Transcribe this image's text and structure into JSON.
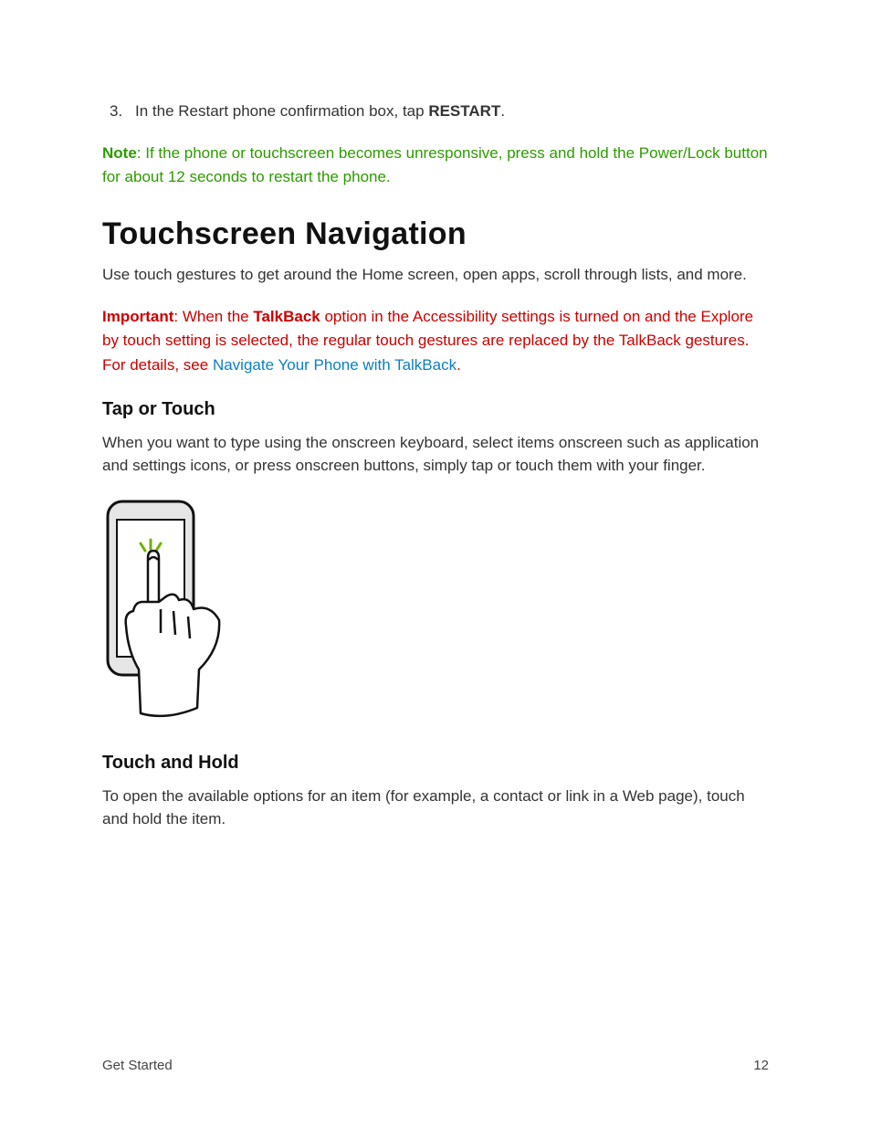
{
  "list": {
    "marker": "3.",
    "prefix": "In the Restart phone confirmation box, tap ",
    "bold": "RESTART",
    "suffix": "."
  },
  "note": {
    "label": "Note",
    "rest": ": If the phone or touchscreen becomes unresponsive, press and hold the Power/Lock button for about 12 seconds to restart the phone."
  },
  "heading": "Touchscreen Navigation",
  "intro": "Use touch gestures to get around the Home screen, open apps, scroll through lists, and more.",
  "important": {
    "label": "Important",
    "p1": ": When the ",
    "bold": "TalkBack",
    "p2": " option in the Accessibility settings is turned on and the Explore by touch setting is selected, the regular touch gestures are replaced by the TalkBack gestures. For details, see ",
    "link": "Navigate Your Phone with TalkBack",
    "tail": "."
  },
  "sub1": "Tap or Touch",
  "sub1_body": "When you want to type using the onscreen keyboard, select items onscreen such as application and settings icons, or press onscreen buttons, simply tap or touch them with your finger.",
  "sub2": "Touch and Hold",
  "sub2_body": "To open the available options for an item (for example, a contact or link in a Web page), touch and hold the item.",
  "footer": {
    "section": "Get Started",
    "page": "12"
  }
}
